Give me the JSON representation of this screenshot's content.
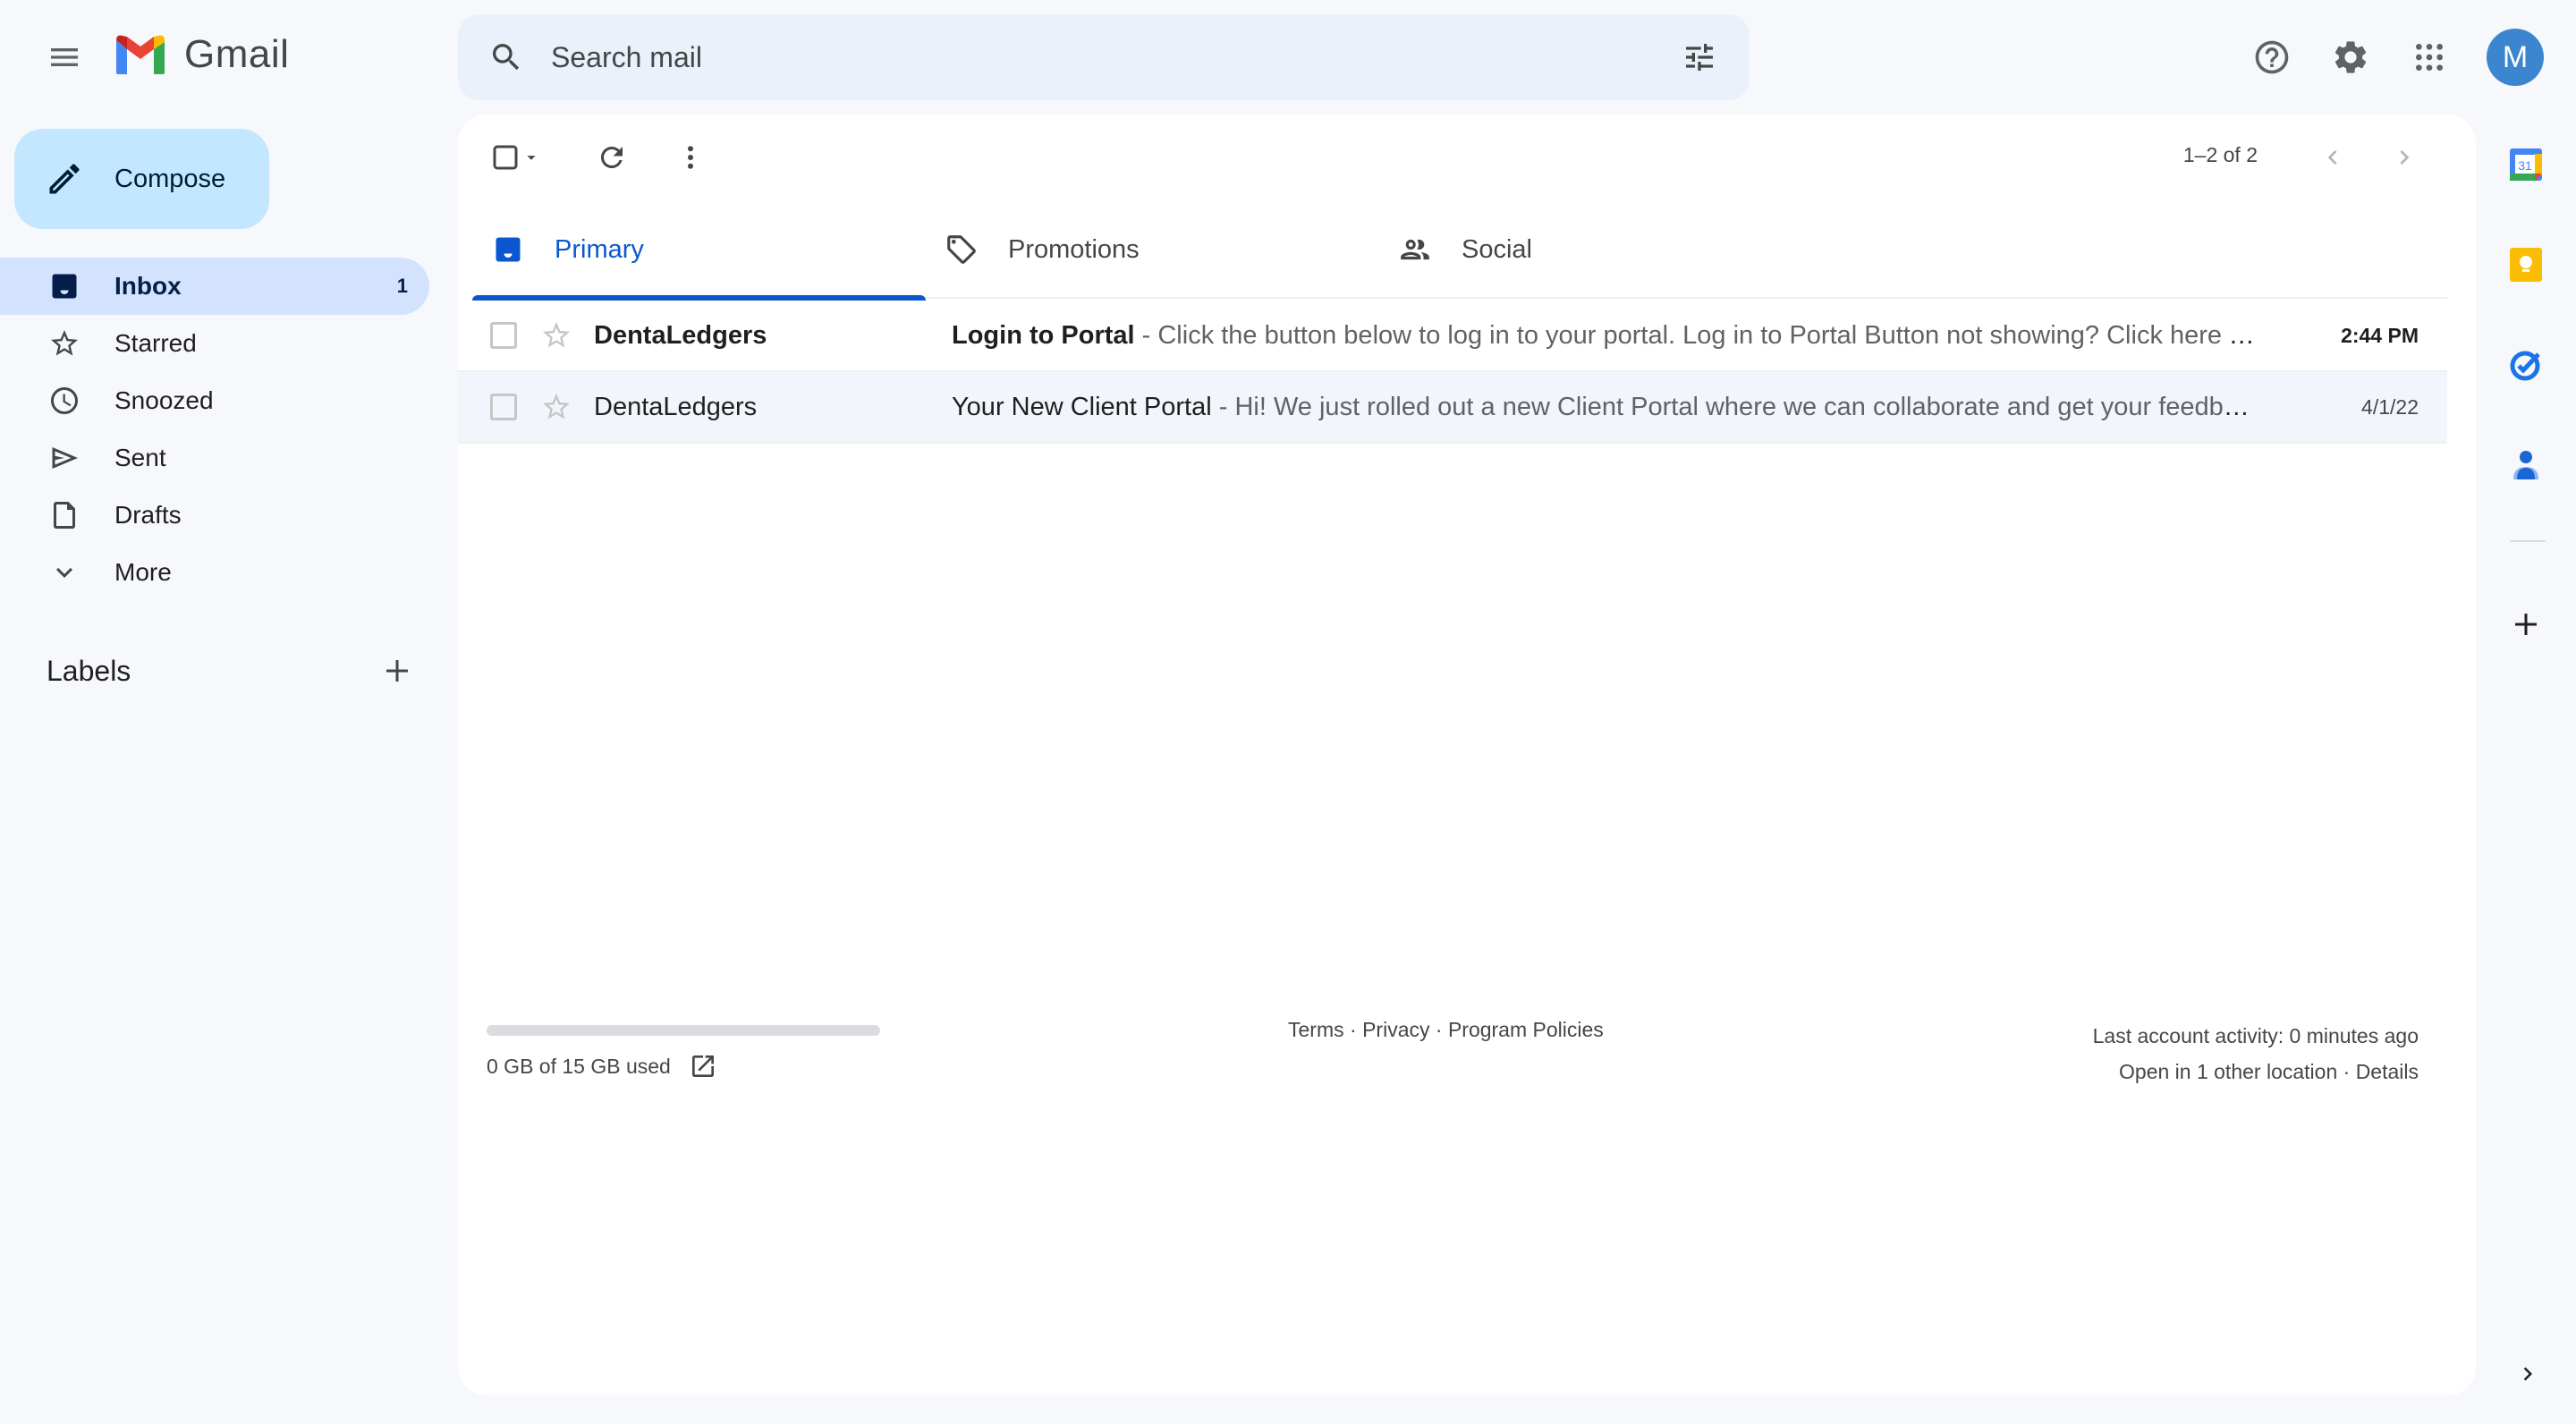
{
  "app": {
    "name": "Gmail"
  },
  "header": {
    "search_placeholder": "Search mail",
    "avatar_initial": "M",
    "icons": [
      "menu-icon",
      "search-icon",
      "search-options-icon",
      "help-icon",
      "settings-icon",
      "apps-icon"
    ]
  },
  "sidebar": {
    "compose_label": "Compose",
    "items": [
      {
        "label": "Inbox",
        "icon": "inbox-icon",
        "count": "1",
        "active": true
      },
      {
        "label": "Starred",
        "icon": "star-icon",
        "count": "",
        "active": false
      },
      {
        "label": "Snoozed",
        "icon": "clock-icon",
        "count": "",
        "active": false
      },
      {
        "label": "Sent",
        "icon": "send-icon",
        "count": "",
        "active": false
      },
      {
        "label": "Drafts",
        "icon": "draft-icon",
        "count": "",
        "active": false
      },
      {
        "label": "More",
        "icon": "chevron-down-icon",
        "count": "",
        "active": false
      }
    ],
    "labels_title": "Labels"
  },
  "toolbar": {
    "pagination": "1–2 of 2"
  },
  "tabs": [
    {
      "label": "Primary",
      "icon": "inbox-icon",
      "active": true
    },
    {
      "label": "Promotions",
      "icon": "tag-icon",
      "active": false
    },
    {
      "label": "Social",
      "icon": "people-icon",
      "active": false
    }
  ],
  "emails": [
    {
      "sender": "DentaLedgers",
      "subject": "Login to Portal",
      "snippet": " - Click the button below to log in to your portal. Log in to Portal Button not showing? Click here T...",
      "date": "2:44 PM",
      "unread": true
    },
    {
      "sender": "DentaLedgers",
      "subject": "Your New Client Portal",
      "snippet": " - Hi! We just rolled out a new Client Portal where we can collaborate and get your feedbac...",
      "date": "4/1/22",
      "unread": false
    }
  ],
  "footer": {
    "storage_text": "0 GB of 15 GB used",
    "storage_used_fraction": 0,
    "links": [
      "Terms",
      "Privacy",
      "Program Policies"
    ],
    "separator": " · ",
    "activity_line1": "Last account activity: 0 minutes ago",
    "activity_line2_prefix": "Open in 1 other location · ",
    "activity_details": "Details"
  },
  "side_panel": {
    "apps": [
      "Calendar",
      "Keep",
      "Tasks",
      "Contacts"
    ],
    "calendar_day": "31"
  },
  "colors": {
    "accent": "#0b57d0",
    "compose_bg": "#c2e7ff",
    "active_nav_bg": "#d3e3fd",
    "avatar_bg": "#3b86cf",
    "page_bg": "#f6f8fc"
  }
}
